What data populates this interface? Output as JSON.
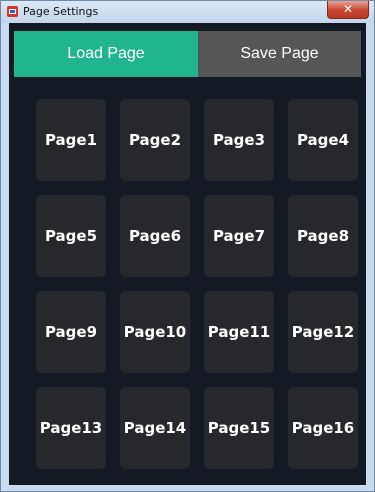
{
  "window": {
    "title": "Page Settings",
    "close_glyph": "✕",
    "app_icon": "app-icon"
  },
  "tabs": [
    {
      "label": "Load Page",
      "active": true,
      "color": "#21b58e"
    },
    {
      "label": "Save Page",
      "active": false,
      "color": "#565656"
    }
  ],
  "pages": [
    {
      "label": "Page1"
    },
    {
      "label": "Page2"
    },
    {
      "label": "Page3"
    },
    {
      "label": "Page4"
    },
    {
      "label": "Page5"
    },
    {
      "label": "Page6"
    },
    {
      "label": "Page7"
    },
    {
      "label": "Page8"
    },
    {
      "label": "Page9"
    },
    {
      "label": "Page10"
    },
    {
      "label": "Page11"
    },
    {
      "label": "Page12"
    },
    {
      "label": "Page13"
    },
    {
      "label": "Page14"
    },
    {
      "label": "Page15"
    },
    {
      "label": "Page16"
    }
  ],
  "colors": {
    "background": "#141a23",
    "page_button": "#26282b",
    "accent": "#21b58e"
  }
}
